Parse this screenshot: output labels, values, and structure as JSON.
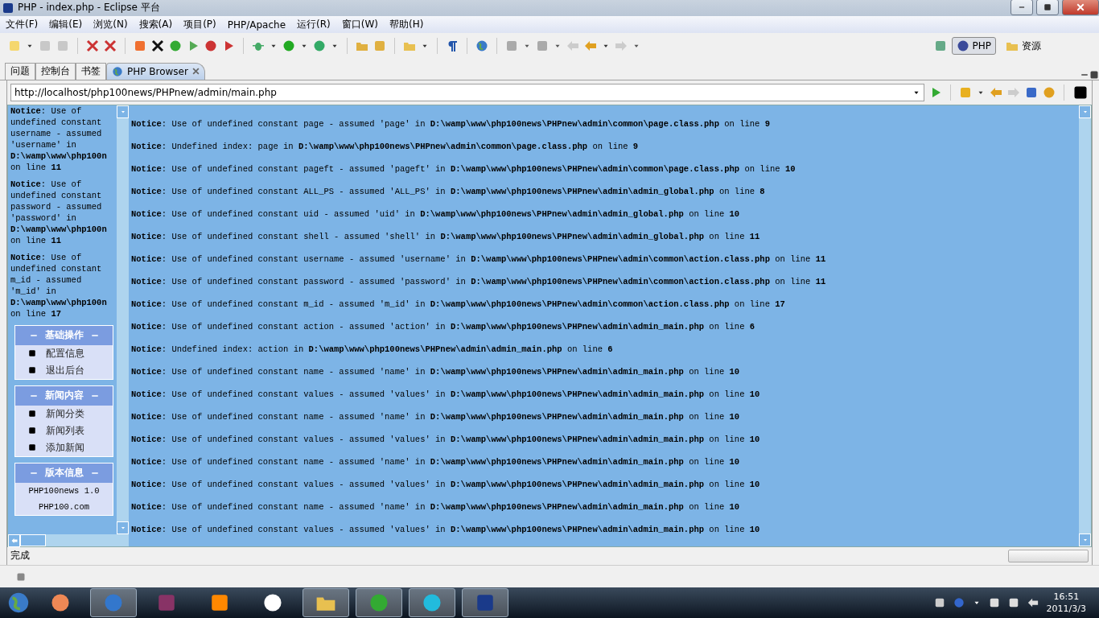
{
  "window": {
    "title": "PHP  -  index.php  -  Eclipse 平台"
  },
  "menu": [
    "文件(F)",
    "编辑(E)",
    "浏览(N)",
    "搜索(A)",
    "项目(P)",
    "PHP/Apache",
    "运行(R)",
    "窗口(W)",
    "帮助(H)"
  ],
  "perspectives": [
    {
      "label": "PHP",
      "selected": true
    },
    {
      "label": "资源",
      "selected": false
    }
  ],
  "tabs": [
    {
      "label": "问题",
      "selected": false
    },
    {
      "label": "控制台",
      "selected": false
    },
    {
      "label": "书签",
      "selected": false
    },
    {
      "label": "PHP Browser",
      "selected": true
    }
  ],
  "browser": {
    "url": "http://localhost/php100news/PHPnew/admin/main.php",
    "left_notices": [
      "**Notice**: Use of undefined constant username - assumed 'username' in **D:\\wamp\\www\\php100n** on line **11**",
      "**Notice**: Use of undefined constant password - assumed 'password' in **D:\\wamp\\www\\php100n** on line **11**",
      "**Notice**: Use of undefined constant m_id - assumed 'm_id' in **D:\\wamp\\www\\php100n** on line **17**"
    ],
    "menu_boxes": [
      {
        "title": "基础操作",
        "kind": "links",
        "items": [
          "配置信息",
          "退出后台"
        ]
      },
      {
        "title": "新闻内容",
        "kind": "links",
        "items": [
          "新闻分类",
          "新闻列表",
          "添加新闻"
        ]
      },
      {
        "title": "版本信息",
        "kind": "info",
        "items": [
          "PHP100news 1.0",
          "PHP100.com"
        ]
      }
    ],
    "notices": [
      "**Notice**: Use of undefined constant page - assumed 'page' in **D:\\wamp\\www\\php100news\\PHPnew\\admin\\common\\page.class.php** on line **9**",
      "**Notice**: Undefined index: page in **D:\\wamp\\www\\php100news\\PHPnew\\admin\\common\\page.class.php** on line **9**",
      "**Notice**: Use of undefined constant pageft - assumed 'pageft' in **D:\\wamp\\www\\php100news\\PHPnew\\admin\\common\\page.class.php** on line **10**",
      "**Notice**: Use of undefined constant ALL_PS - assumed 'ALL_PS' in **D:\\wamp\\www\\php100news\\PHPnew\\admin\\admin_global.php** on line **8**",
      "**Notice**: Use of undefined constant uid - assumed 'uid' in **D:\\wamp\\www\\php100news\\PHPnew\\admin\\admin_global.php** on line **10**",
      "**Notice**: Use of undefined constant shell - assumed 'shell' in **D:\\wamp\\www\\php100news\\PHPnew\\admin\\admin_global.php** on line **11**",
      "**Notice**: Use of undefined constant username - assumed 'username' in **D:\\wamp\\www\\php100news\\PHPnew\\admin\\common\\action.class.php** on line **11**",
      "**Notice**: Use of undefined constant password - assumed 'password' in **D:\\wamp\\www\\php100news\\PHPnew\\admin\\common\\action.class.php** on line **11**",
      "**Notice**: Use of undefined constant m_id - assumed 'm_id' in **D:\\wamp\\www\\php100news\\PHPnew\\admin\\common\\action.class.php** on line **17**",
      "**Notice**: Use of undefined constant action - assumed 'action' in **D:\\wamp\\www\\php100news\\PHPnew\\admin\\admin_main.php** on line **6**",
      "**Notice**: Undefined index: action in **D:\\wamp\\www\\php100news\\PHPnew\\admin\\admin_main.php** on line **6**",
      "**Notice**: Use of undefined constant name - assumed 'name' in **D:\\wamp\\www\\php100news\\PHPnew\\admin\\admin_main.php** on line **10**",
      "**Notice**: Use of undefined constant values - assumed 'values' in **D:\\wamp\\www\\php100news\\PHPnew\\admin\\admin_main.php** on line **10**",
      "**Notice**: Use of undefined constant name - assumed 'name' in **D:\\wamp\\www\\php100news\\PHPnew\\admin\\admin_main.php** on line **10**",
      "**Notice**: Use of undefined constant values - assumed 'values' in **D:\\wamp\\www\\php100news\\PHPnew\\admin\\admin_main.php** on line **10**",
      "**Notice**: Use of undefined constant name - assumed 'name' in **D:\\wamp\\www\\php100news\\PHPnew\\admin\\admin_main.php** on line **10**",
      "**Notice**: Use of undefined constant values - assumed 'values' in **D:\\wamp\\www\\php100news\\PHPnew\\admin\\admin_main.php** on line **10**",
      "**Notice**: Use of undefined constant name - assumed 'name' in **D:\\wamp\\www\\php100news\\PHPnew\\admin\\admin_main.php** on line **10**",
      "**Notice**: Use of undefined constant values - assumed 'values' in **D:\\wamp\\www\\php100news\\PHPnew\\admin\\admin_main.php** on line **10**"
    ],
    "status": "完成",
    "progress": {
      "level": 0
    }
  },
  "taskbar": {
    "time": "16:51",
    "date": "2011/3/3"
  }
}
